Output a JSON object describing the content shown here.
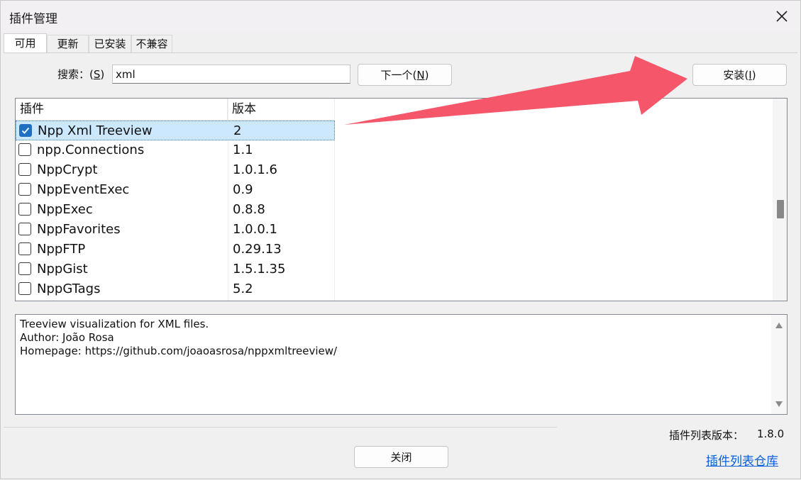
{
  "window": {
    "title": "插件管理"
  },
  "tabs": [
    {
      "label": "可用",
      "active": true
    },
    {
      "label": "更新",
      "active": false
    },
    {
      "label": "已安装",
      "active": false
    },
    {
      "label": "不兼容",
      "active": false
    }
  ],
  "search": {
    "label_prefix": "搜索：(",
    "label_key": "S",
    "label_suffix": ")",
    "value": "xml"
  },
  "buttons": {
    "next_prefix": "下一个(",
    "next_key": "N",
    "next_suffix": ")",
    "install_prefix": "安装(",
    "install_key": "I",
    "install_suffix": ")",
    "close": "关闭"
  },
  "list": {
    "columns": {
      "name": "插件",
      "version": "版本"
    },
    "rows": [
      {
        "name": "Npp Xml Treeview",
        "version": "2",
        "checked": true,
        "selected": true
      },
      {
        "name": "npp.Connections",
        "version": "1.1",
        "checked": false,
        "selected": false
      },
      {
        "name": "NppCrypt",
        "version": "1.0.1.6",
        "checked": false,
        "selected": false
      },
      {
        "name": "NppEventExec",
        "version": "0.9",
        "checked": false,
        "selected": false
      },
      {
        "name": "NppExec",
        "version": "0.8.8",
        "checked": false,
        "selected": false
      },
      {
        "name": "NppFavorites",
        "version": "1.0.0.1",
        "checked": false,
        "selected": false
      },
      {
        "name": "NppFTP",
        "version": "0.29.13",
        "checked": false,
        "selected": false
      },
      {
        "name": "NppGist",
        "version": "1.5.1.35",
        "checked": false,
        "selected": false
      },
      {
        "name": "NppGTags",
        "version": "5.2",
        "checked": false,
        "selected": false
      }
    ]
  },
  "description": {
    "lines": [
      "Treeview visualization for XML files.",
      "Author: João Rosa",
      "Homepage: https://github.com/joaoasrosa/nppxmltreeview/"
    ]
  },
  "footer": {
    "list_version_label": "插件列表版本：",
    "list_version_value": "1.8.0",
    "repo_link": "插件列表仓库"
  },
  "colors": {
    "arrow": "#f5566a",
    "accent": "#1f6fc2",
    "selection": "#cce8ff",
    "link": "#0a5ed7"
  },
  "icons": {
    "close": "close-icon",
    "check": "checkmark-icon",
    "arrow": "arrow-annotation-icon"
  }
}
